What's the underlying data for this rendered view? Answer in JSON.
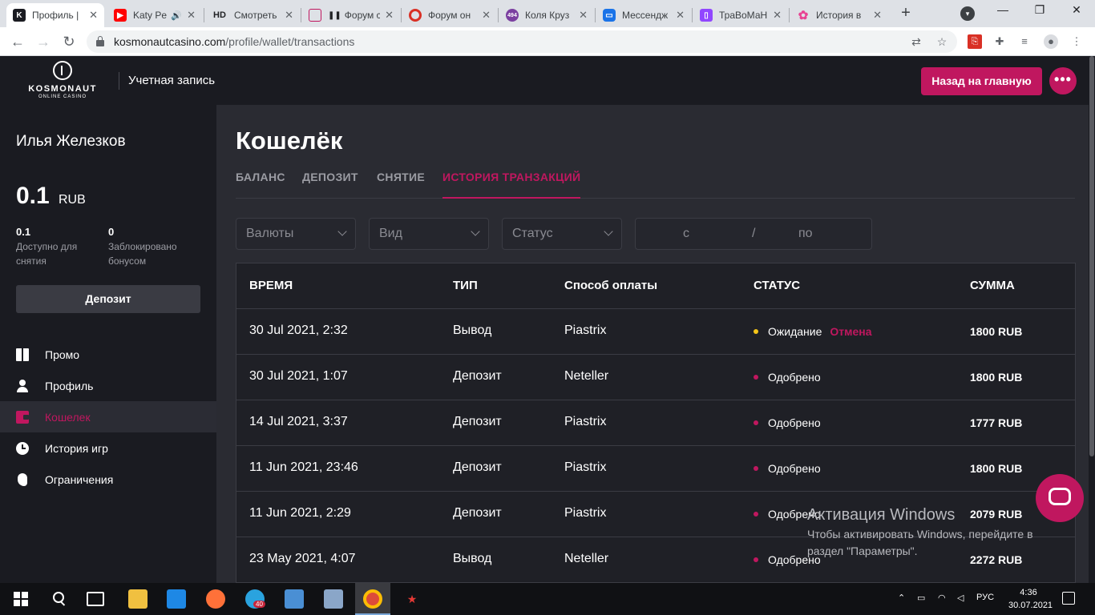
{
  "browser": {
    "tabs": [
      {
        "title": "Профиль | ",
        "favicon": "kosmonaut",
        "color": "#1a1b21",
        "active": true
      },
      {
        "title": "Katy Pe",
        "favicon": "youtube",
        "color": "#ff0000",
        "audio": true
      },
      {
        "title": "Смотреть с",
        "favicon": "HD",
        "color": "#202124"
      },
      {
        "title": "Форум с",
        "favicon": "forum",
        "color": "#c0175f",
        "paused": true
      },
      {
        "title": "Форум он",
        "favicon": "ring",
        "color": "#d93025"
      },
      {
        "title": "Коля Круз",
        "favicon": "494",
        "color": "#7b3fa0"
      },
      {
        "title": "Мессендж",
        "favicon": "messenger",
        "color": "#1a73e8"
      },
      {
        "title": "ТраВоМаН",
        "favicon": "twitch",
        "color": "#9146ff"
      },
      {
        "title": "История в",
        "favicon": "flower",
        "color": "#e84393"
      }
    ],
    "url": "kosmonautcasino.com",
    "url_path": "/profile/wallet/transactions"
  },
  "header": {
    "logo_name": "KOSMONAUT",
    "logo_sub": "ONLINE CASINO",
    "section_title": "Учетная запись",
    "home_button": "Назад на главную",
    "more_button": "•••"
  },
  "sidebar": {
    "user_name": "Илья Железков",
    "balance": "0.1",
    "currency": "RUB",
    "available_value": "0.1",
    "available_label": "Доступно для снятия",
    "blocked_value": "0",
    "blocked_label": "Заблокировано бонусом",
    "deposit_button": "Депозит",
    "items": [
      {
        "label": "Промо",
        "icon": "gift-icon"
      },
      {
        "label": "Профиль",
        "icon": "user-icon"
      },
      {
        "label": "Кошелек",
        "icon": "wallet-icon",
        "active": true
      },
      {
        "label": "История игр",
        "icon": "clock-icon"
      },
      {
        "label": "Ограничения",
        "icon": "hand-icon"
      }
    ]
  },
  "main": {
    "title": "Кошелёк",
    "tabs": [
      {
        "label": "БАЛАНС"
      },
      {
        "label": "ДЕПОЗИТ"
      },
      {
        "label": "СНЯТИЕ"
      },
      {
        "label": "ИСТОРИЯ ТРАНЗАКЦИЙ",
        "active": true
      }
    ],
    "filters": {
      "currency": "Валюты",
      "type": "Вид",
      "status": "Статус",
      "date_from": "с",
      "date_sep": "/",
      "date_to": "по"
    },
    "table": {
      "headers": {
        "time": "ВРЕМЯ",
        "type": "ТИП",
        "method": "Способ оплаты",
        "status": "СТАТУС",
        "amount": "СУММА"
      },
      "rows": [
        {
          "time": "30 Jul 2021, 2:32",
          "type": "Вывод",
          "method": "Piastrix",
          "status": "Ожидание",
          "status_color": "#f5c518",
          "cancel": "Отмена",
          "amount": "1800 RUB"
        },
        {
          "time": "30 Jul 2021, 1:07",
          "type": "Депозит",
          "method": "Neteller",
          "status": "Одобрено",
          "status_color": "#c0175f",
          "amount": "1800 RUB"
        },
        {
          "time": "14 Jul 2021, 3:37",
          "type": "Депозит",
          "method": "Piastrix",
          "status": "Одобрено",
          "status_color": "#c0175f",
          "amount": "1777 RUB"
        },
        {
          "time": "11 Jun 2021, 23:46",
          "type": "Депозит",
          "method": "Piastrix",
          "status": "Одобрено",
          "status_color": "#c0175f",
          "amount": "1800 RUB"
        },
        {
          "time": "11 Jun 2021, 2:29",
          "type": "Депозит",
          "method": "Piastrix",
          "status": "Одобрено",
          "status_color": "#c0175f",
          "amount": "2079 RUB"
        },
        {
          "time": "23 May 2021, 4:07",
          "type": "Вывод",
          "method": "Neteller",
          "status": "Одобрено",
          "status_color": "#c0175f",
          "amount": "2272 RUB"
        }
      ]
    }
  },
  "windows_activation": {
    "title": "Активация Windows",
    "line": "Чтобы активировать Windows, перейдите в раздел \"Параметры\"."
  },
  "taskbar": {
    "language": "РУС",
    "time": "4:36",
    "date": "30.07.2021",
    "telegram_badge": "40"
  },
  "colors": {
    "accent": "#c0175f",
    "pending": "#f5c518",
    "background": "#1a1b21",
    "panel": "#2a2b32"
  }
}
